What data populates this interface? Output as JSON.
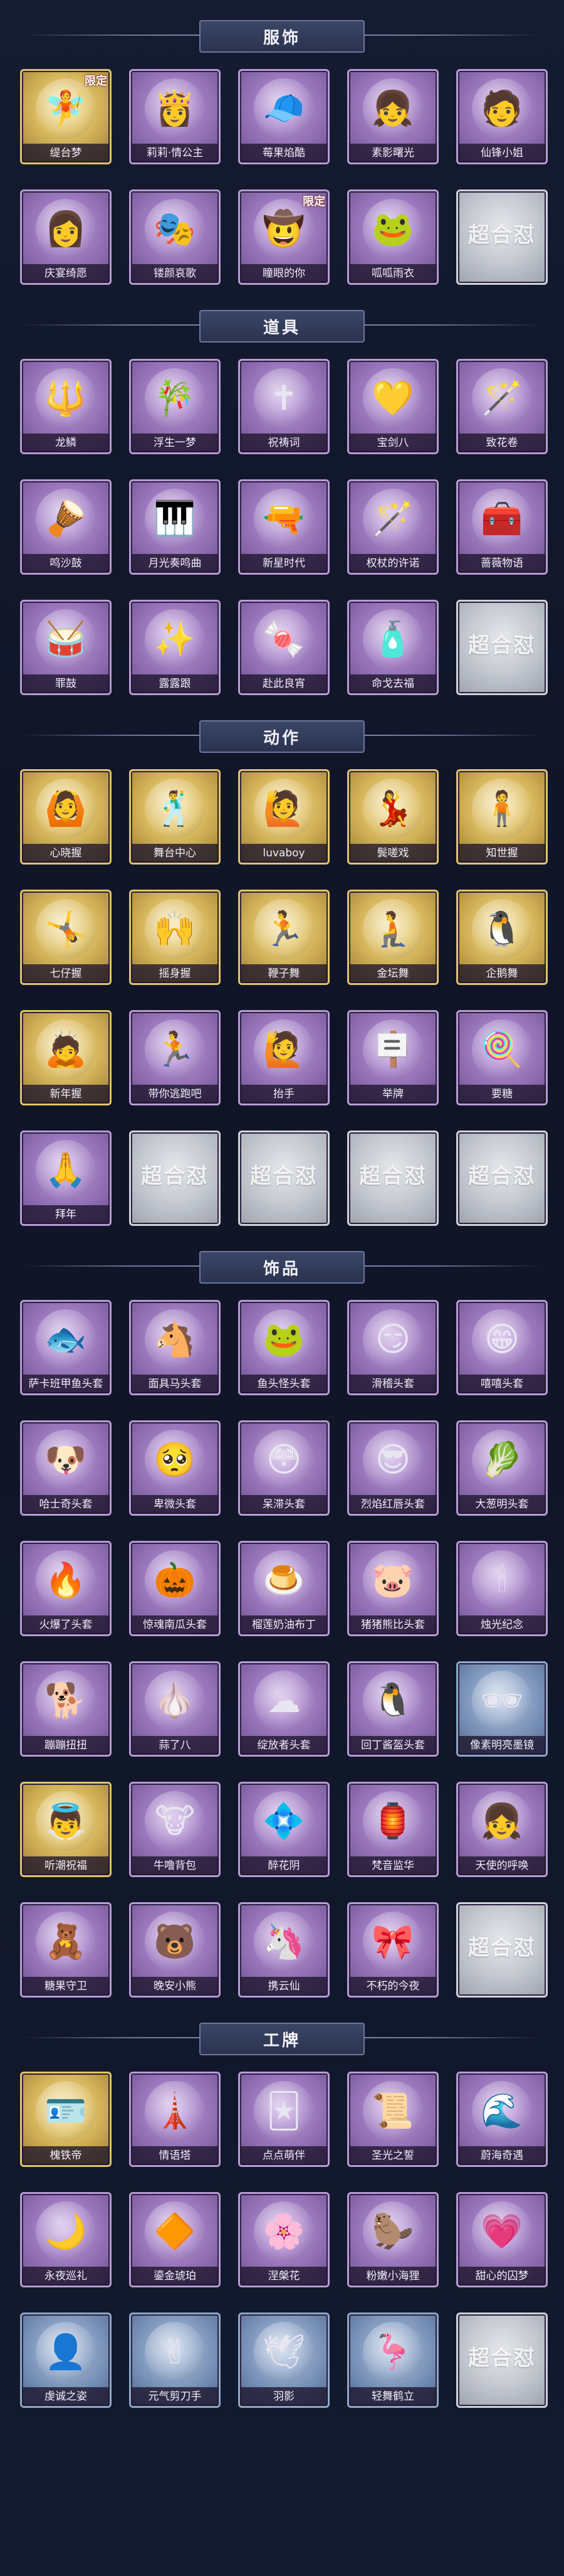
{
  "watermark": "超合怼",
  "sections": [
    {
      "title": "服饰",
      "items": [
        {
          "label": "缇台梦",
          "rarity": "gold",
          "icon": "🧚",
          "tag": "限定"
        },
        {
          "label": "莉莉·情公主",
          "rarity": "purple",
          "icon": "👸",
          "tag": ""
        },
        {
          "label": "莓果焰酷",
          "rarity": "purple",
          "icon": "🧢",
          "tag": ""
        },
        {
          "label": "素影曙光",
          "rarity": "purple",
          "icon": "👧",
          "tag": ""
        },
        {
          "label": "仙锋小姐",
          "rarity": "purple",
          "icon": "🧑",
          "tag": ""
        },
        {
          "label": "庆宴绮愿",
          "rarity": "purple",
          "icon": "👩",
          "tag": ""
        },
        {
          "label": "镂颜哀歌",
          "rarity": "purple",
          "icon": "🎭",
          "tag": ""
        },
        {
          "label": "瞳眼的你",
          "rarity": "purple",
          "icon": "🤠",
          "tag": "限定"
        },
        {
          "label": "呱呱雨衣",
          "rarity": "purple",
          "icon": "🐸",
          "tag": ""
        },
        {
          "label": "",
          "rarity": "grey",
          "icon": "",
          "tag": ""
        }
      ]
    },
    {
      "title": "道具",
      "items": [
        {
          "label": "龙鳞",
          "rarity": "purple",
          "icon": "🔱",
          "tag": ""
        },
        {
          "label": "浮生一梦",
          "rarity": "purple",
          "icon": "🎋",
          "tag": ""
        },
        {
          "label": "祝祷词",
          "rarity": "purple",
          "icon": "✝",
          "tag": ""
        },
        {
          "label": "宝剑八",
          "rarity": "purple",
          "icon": "💛",
          "tag": ""
        },
        {
          "label": "致花卷",
          "rarity": "purple",
          "icon": "🪄",
          "tag": ""
        },
        {
          "label": "鸣沙鼓",
          "rarity": "purple",
          "icon": "🪘",
          "tag": ""
        },
        {
          "label": "月光奏鸣曲",
          "rarity": "purple",
          "icon": "🎹",
          "tag": ""
        },
        {
          "label": "新星时代",
          "rarity": "purple",
          "icon": "🔫",
          "tag": ""
        },
        {
          "label": "权杖的许诺",
          "rarity": "purple",
          "icon": "🪄",
          "tag": ""
        },
        {
          "label": "蔷薇物语",
          "rarity": "purple",
          "icon": "🧰",
          "tag": ""
        },
        {
          "label": "罪鼓",
          "rarity": "purple",
          "icon": "🥁",
          "tag": ""
        },
        {
          "label": "露露跟",
          "rarity": "purple",
          "icon": "✨",
          "tag": ""
        },
        {
          "label": "赴此良宵",
          "rarity": "purple",
          "icon": "🍬",
          "tag": ""
        },
        {
          "label": "命戈去福",
          "rarity": "purple",
          "icon": "🧴",
          "tag": ""
        },
        {
          "label": "",
          "rarity": "grey",
          "icon": "",
          "tag": ""
        }
      ]
    },
    {
      "title": "动作",
      "items": [
        {
          "label": "心晓握",
          "rarity": "gold",
          "icon": "🙆",
          "tag": ""
        },
        {
          "label": "舞台中心",
          "rarity": "gold",
          "icon": "🕺",
          "tag": ""
        },
        {
          "label": "luvaboy",
          "rarity": "gold",
          "icon": "🙋",
          "tag": ""
        },
        {
          "label": "鬓嗟戏",
          "rarity": "gold",
          "icon": "💃",
          "tag": ""
        },
        {
          "label": "知世握",
          "rarity": "gold",
          "icon": "🧍",
          "tag": ""
        },
        {
          "label": "七仔握",
          "rarity": "gold",
          "icon": "🤸",
          "tag": ""
        },
        {
          "label": "摇身握",
          "rarity": "gold",
          "icon": "🙌",
          "tag": ""
        },
        {
          "label": "鞭子舞",
          "rarity": "gold",
          "icon": "🏃",
          "tag": ""
        },
        {
          "label": "金坛舞",
          "rarity": "gold",
          "icon": "🧎",
          "tag": ""
        },
        {
          "label": "企鹅舞",
          "rarity": "gold",
          "icon": "🐧",
          "tag": ""
        },
        {
          "label": "新年握",
          "rarity": "gold",
          "icon": "🙇",
          "tag": ""
        },
        {
          "label": "带你逃跑吧",
          "rarity": "purple",
          "icon": "🏃",
          "tag": ""
        },
        {
          "label": "抬手",
          "rarity": "purple",
          "icon": "🙋",
          "tag": ""
        },
        {
          "label": "举牌",
          "rarity": "purple",
          "icon": "🪧",
          "tag": ""
        },
        {
          "label": "要糖",
          "rarity": "purple",
          "icon": "🍭",
          "tag": ""
        },
        {
          "label": "拜年",
          "rarity": "purple",
          "icon": "🙏",
          "tag": ""
        },
        {
          "label": "",
          "rarity": "grey",
          "icon": "",
          "tag": ""
        },
        {
          "label": "",
          "rarity": "grey",
          "icon": "",
          "tag": ""
        },
        {
          "label": "",
          "rarity": "grey",
          "icon": "",
          "tag": ""
        },
        {
          "label": "",
          "rarity": "grey",
          "icon": "",
          "tag": ""
        }
      ]
    },
    {
      "title": "饰品",
      "items": [
        {
          "label": "萨卡班甲鱼头套",
          "rarity": "purple",
          "icon": "🐟",
          "tag": ""
        },
        {
          "label": "面具马头套",
          "rarity": "purple",
          "icon": "🐴",
          "tag": ""
        },
        {
          "label": "鱼头怪头套",
          "rarity": "purple",
          "icon": "🐸",
          "tag": ""
        },
        {
          "label": "滑稽头套",
          "rarity": "purple",
          "icon": "😏",
          "tag": ""
        },
        {
          "label": "嘻嘻头套",
          "rarity": "purple",
          "icon": "😁",
          "tag": ""
        },
        {
          "label": "哈士奇头套",
          "rarity": "purple",
          "icon": "🐶",
          "tag": ""
        },
        {
          "label": "卑微头套",
          "rarity": "purple",
          "icon": "🥺",
          "tag": ""
        },
        {
          "label": "呆滞头套",
          "rarity": "purple",
          "icon": "😳",
          "tag": ""
        },
        {
          "label": "烈焰红唇头套",
          "rarity": "purple",
          "icon": "😎",
          "tag": ""
        },
        {
          "label": "大葱明头套",
          "rarity": "purple",
          "icon": "🥬",
          "tag": ""
        },
        {
          "label": "火爆了头套",
          "rarity": "purple",
          "icon": "🔥",
          "tag": ""
        },
        {
          "label": "惊魂南瓜头套",
          "rarity": "purple",
          "icon": "🎃",
          "tag": ""
        },
        {
          "label": "榴莲奶油布丁",
          "rarity": "purple",
          "icon": "🍮",
          "tag": ""
        },
        {
          "label": "猪猪熊比头套",
          "rarity": "purple",
          "icon": "🐷",
          "tag": ""
        },
        {
          "label": "烛光纪念",
          "rarity": "purple",
          "icon": "🕯",
          "tag": ""
        },
        {
          "label": "蹦蹦扭扭",
          "rarity": "purple",
          "icon": "🐕",
          "tag": ""
        },
        {
          "label": "蒜了八",
          "rarity": "purple",
          "icon": "🧄",
          "tag": ""
        },
        {
          "label": "绽放者头套",
          "rarity": "purple",
          "icon": "☁",
          "tag": ""
        },
        {
          "label": "回丁酱盔头套",
          "rarity": "purple",
          "icon": "🐧",
          "tag": ""
        },
        {
          "label": "像素明亮墨镜",
          "rarity": "blue",
          "icon": "🕶",
          "tag": ""
        },
        {
          "label": "听潮祝福",
          "rarity": "gold",
          "icon": "👼",
          "tag": ""
        },
        {
          "label": "牛噜背包",
          "rarity": "purple",
          "icon": "🐮",
          "tag": ""
        },
        {
          "label": "醉花阴",
          "rarity": "purple",
          "icon": "💠",
          "tag": ""
        },
        {
          "label": "梵音监华",
          "rarity": "purple",
          "icon": "🏮",
          "tag": ""
        },
        {
          "label": "天使的呼唤",
          "rarity": "purple",
          "icon": "👧",
          "tag": ""
        },
        {
          "label": "糖果守卫",
          "rarity": "purple",
          "icon": "🧸",
          "tag": ""
        },
        {
          "label": "晚安小熊",
          "rarity": "purple",
          "icon": "🐻",
          "tag": ""
        },
        {
          "label": "携云仙",
          "rarity": "purple",
          "icon": "🦄",
          "tag": ""
        },
        {
          "label": "不朽的今夜",
          "rarity": "purple",
          "icon": "🎀",
          "tag": ""
        },
        {
          "label": "",
          "rarity": "grey",
          "icon": "",
          "tag": ""
        }
      ]
    },
    {
      "title": "工牌",
      "items": [
        {
          "label": "槐铁帝",
          "rarity": "gold",
          "icon": "🪪",
          "tag": ""
        },
        {
          "label": "情语塔",
          "rarity": "purple",
          "icon": "🗼",
          "tag": ""
        },
        {
          "label": "点点萌伴",
          "rarity": "purple",
          "icon": "🃏",
          "tag": ""
        },
        {
          "label": "圣光之誓",
          "rarity": "purple",
          "icon": "📜",
          "tag": ""
        },
        {
          "label": "蔚海奇遇",
          "rarity": "purple",
          "icon": "🌊",
          "tag": ""
        },
        {
          "label": "永夜巡礼",
          "rarity": "purple",
          "icon": "🌙",
          "tag": ""
        },
        {
          "label": "鎏金琥珀",
          "rarity": "purple",
          "icon": "🔶",
          "tag": ""
        },
        {
          "label": "涅槃花",
          "rarity": "purple",
          "icon": "🌸",
          "tag": ""
        },
        {
          "label": "粉嫩小海狸",
          "rarity": "purple",
          "icon": "🦫",
          "tag": ""
        },
        {
          "label": "甜心的囚梦",
          "rarity": "purple",
          "icon": "💗",
          "tag": ""
        },
        {
          "label": "虔诚之姿",
          "rarity": "blue",
          "icon": "👤",
          "tag": ""
        },
        {
          "label": "元气剪刀手",
          "rarity": "blue",
          "icon": "✌",
          "tag": ""
        },
        {
          "label": "羽影",
          "rarity": "blue",
          "icon": "🕊",
          "tag": ""
        },
        {
          "label": "轻舞鹤立",
          "rarity": "blue",
          "icon": "🦩",
          "tag": ""
        },
        {
          "label": "",
          "rarity": "grey",
          "icon": "",
          "tag": ""
        }
      ]
    }
  ]
}
